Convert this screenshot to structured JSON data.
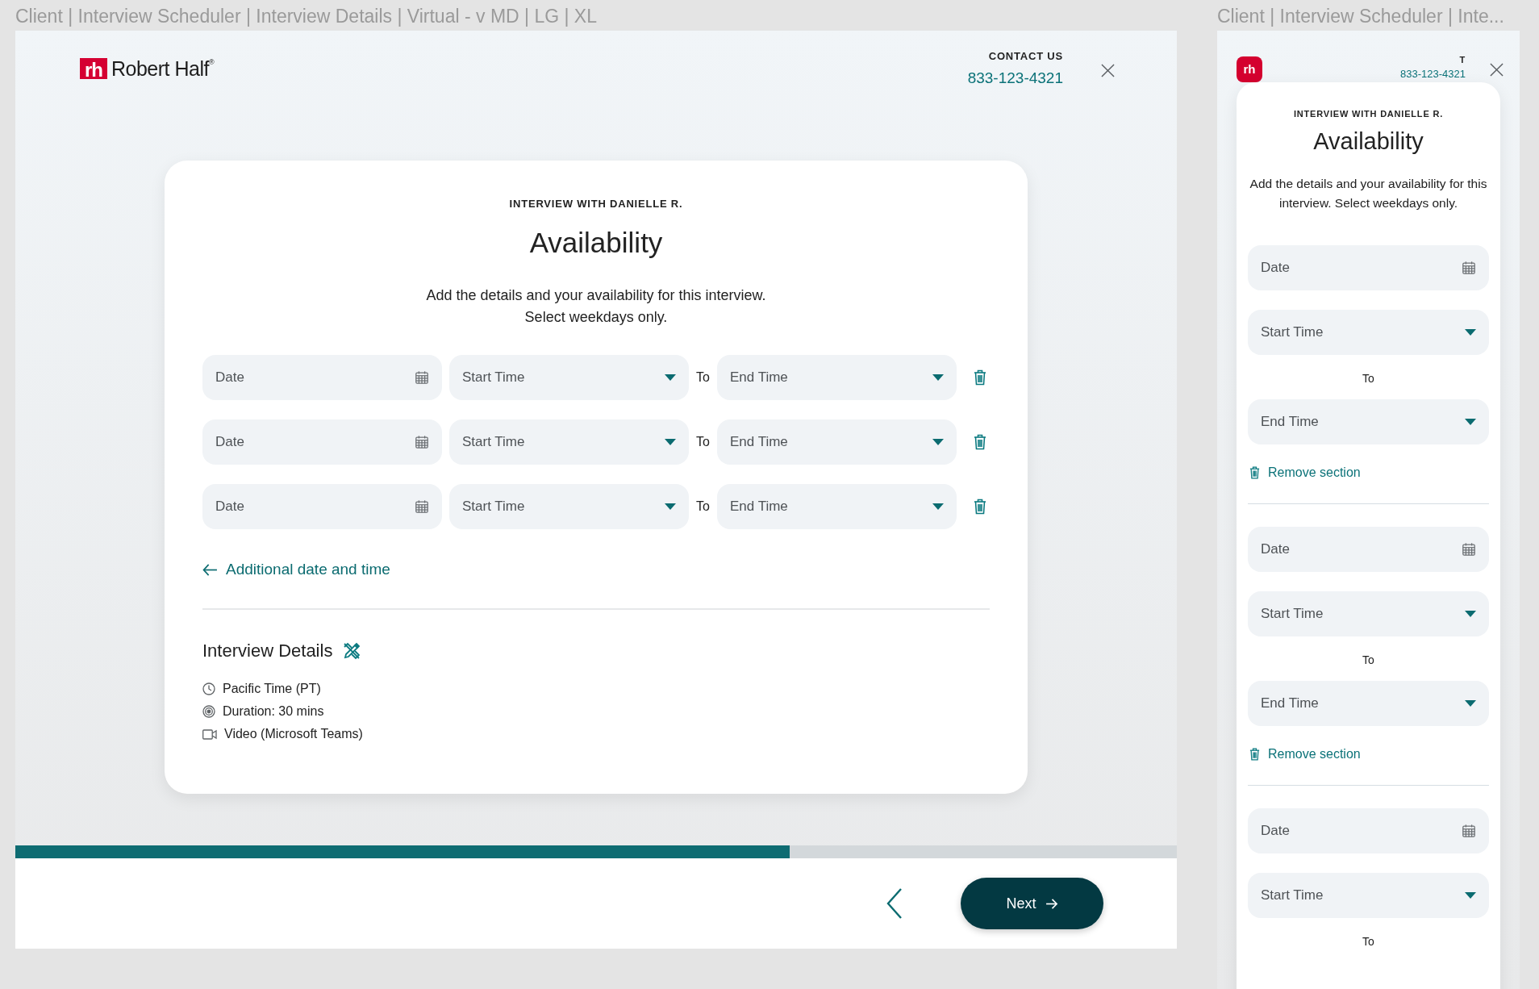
{
  "frames": [
    {
      "kind": "desktop",
      "title": "Client | Interview Scheduler | Interview Details | Virtual - v MD | LG | XL",
      "header": {
        "logo_mark": "rh",
        "logo": "Robert Half$^{®}$",
        "contact_label": "CONTACT US",
        "phone": "833-123-4321"
      },
      "card": {
        "eyebrow": "INTERVIEW WITH DANIELLE R.",
        "heading": "Availability",
        "description": [
          "Add the details and your availability for this interview.",
          "Select weekdays only."
        ],
        "slots": [
          {
            "date": "Date",
            "start": "Start Time",
            "to": "To",
            "end": "End Time"
          },
          {
            "date": "Date",
            "start": "Start Time",
            "to": "To",
            "end": "End Time"
          },
          {
            "date": "Date",
            "start": "Start Time",
            "to": "To",
            "end": "End Time"
          }
        ],
        "add_link": "Additional date and time",
        "details": {
          "heading": "Interview Details",
          "items": [
            {
              "kind": "clock",
              "text": "Pacific Time (PT)"
            },
            {
              "kind": "duration",
              "text": "Duration: 30 mins"
            },
            {
              "kind": "video",
              "text": "Video (Microsoft Teams)"
            }
          ]
        }
      },
      "progress": {
        "level": 0.667
      },
      "footer": {
        "next": "Next"
      }
    },
    {
      "kind": "mobile",
      "title": "Client | Interview Scheduler | Inte...",
      "header": {
        "logo": "rh",
        "contact_label": "T",
        "phone": "833-123-4321"
      },
      "card": {
        "eyebrow": "INTERVIEW WITH DANIELLE R.",
        "heading": "Availability",
        "description": [
          "Add the details and your availability for this interview. Select weekdays only."
        ],
        "slots": [
          {
            "date": "Date",
            "start": "Start Time",
            "to": "To",
            "end": "End Time",
            "remove": "Remove section"
          },
          {
            "date": "Date",
            "start": "Start Time",
            "to": "To",
            "end": "End Time",
            "remove": "Remove section"
          },
          {
            "date": "Date",
            "start": "Start Time",
            "to": "To"
          }
        ]
      }
    }
  ]
}
